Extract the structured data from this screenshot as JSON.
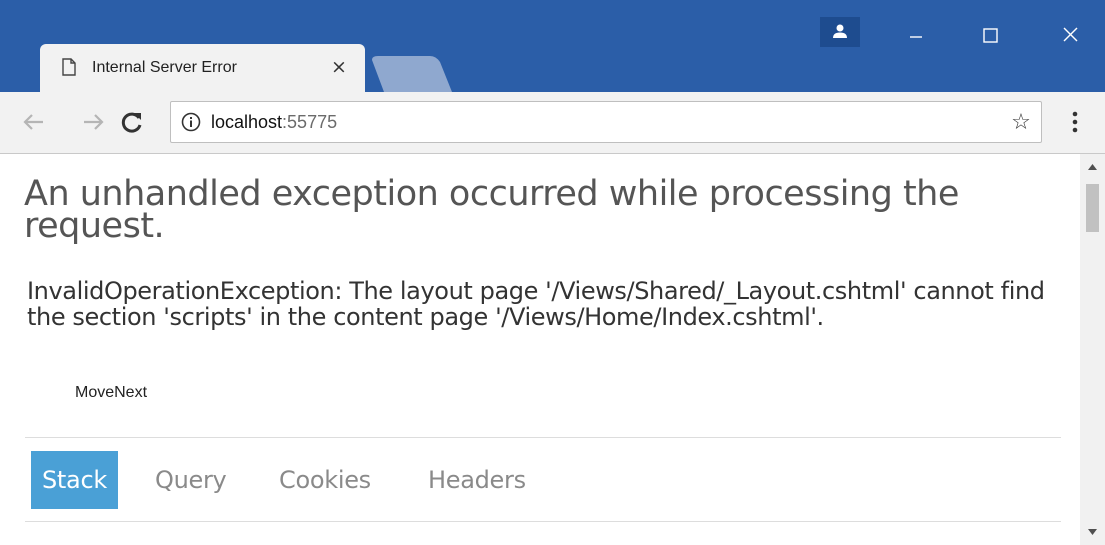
{
  "browser": {
    "tab_title": "Internal Server Error",
    "tab_close_label": "×",
    "url_host": "localhost",
    "url_port": ":55775",
    "colors": {
      "titlebar": "#2b5ea8",
      "toolbar": "#f2f2f2",
      "active_tab_accent": "#4aa0d6"
    },
    "icons": {
      "tab_page": "document-icon",
      "new_tab": "new-tab-icon",
      "profile": "user-icon",
      "minimize": "minimize-icon",
      "maximize": "maximize-icon",
      "close": "close-icon",
      "back": "arrow-left-icon",
      "forward": "arrow-right-icon",
      "reload": "reload-icon",
      "site_info": "info-icon",
      "bookmark": "star-icon",
      "menu": "kebab-menu-icon"
    },
    "bookmark_glyph": "☆"
  },
  "page": {
    "title": "An unhandled exception occurred while processing the request.",
    "message": "InvalidOperationException: The layout page '/Views/Shared/_Layout.cshtml' cannot find the section 'scripts' in the content page '/Views/Home/Index.cshtml'.",
    "location": "MoveNext",
    "tabs": [
      {
        "label": "Stack",
        "active": true
      },
      {
        "label": "Query",
        "active": false
      },
      {
        "label": "Cookies",
        "active": false
      },
      {
        "label": "Headers",
        "active": false
      }
    ]
  }
}
